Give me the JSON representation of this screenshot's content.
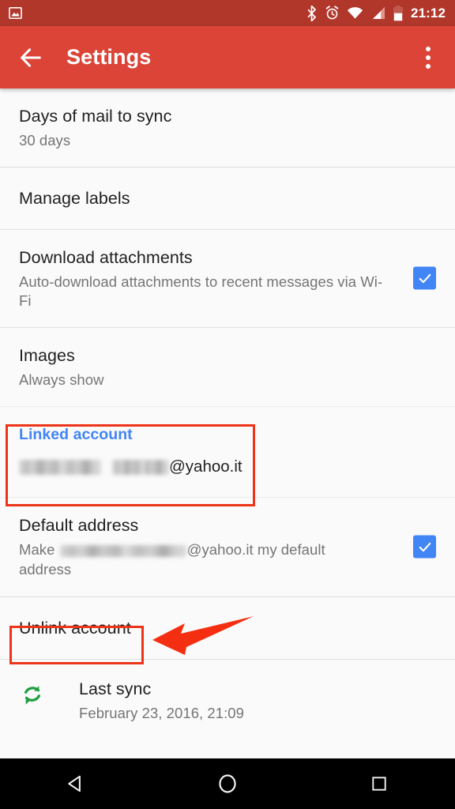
{
  "status_bar": {
    "notification_icon": "image-notification-icon",
    "icons": [
      "bluetooth-icon",
      "alarm-icon",
      "wifi-icon",
      "signal-icon",
      "battery-icon"
    ],
    "battery_level": "48",
    "time": "21:12",
    "background_color": "#b1372b"
  },
  "app_bar": {
    "back_icon": "back-arrow-icon",
    "title": "Settings",
    "overflow_icon": "overflow-menu-icon",
    "background_color": "#db4437"
  },
  "settings": {
    "days_of_mail": {
      "title": "Days of mail to sync",
      "value": "30 days"
    },
    "manage_labels": {
      "title": "Manage labels"
    },
    "download_attachments": {
      "title": "Download attachments",
      "value": "Auto-download attachments to recent messages via Wi-Fi",
      "checked": "true"
    },
    "images": {
      "title": "Images",
      "value": "Always show"
    },
    "linked_account": {
      "title": "Linked account",
      "email_domain": "@yahoo.it",
      "email_redacted": "true",
      "title_color": "#4285f4"
    },
    "default_address": {
      "title": "Default address",
      "value_prefix": "Make ",
      "value_domain": "@yahoo.it",
      "value_suffix": " my default address",
      "checked": "true"
    },
    "unlink_account": {
      "title": "Unlink account"
    },
    "last_sync": {
      "icon": "sync-icon",
      "title": "Last sync",
      "value": "February 23, 2016, 21:09",
      "icon_color": "#1e9e40"
    }
  },
  "annotations": {
    "color": "#ed3419",
    "box_linked_account": "highlight-box-linked-account",
    "box_unlink_account": "highlight-box-unlink-account",
    "arrow": "pointer-arrow-to-unlink-account"
  },
  "nav_bar": {
    "back": "nav-back-icon",
    "home": "nav-home-icon",
    "recents": "nav-recents-icon"
  }
}
